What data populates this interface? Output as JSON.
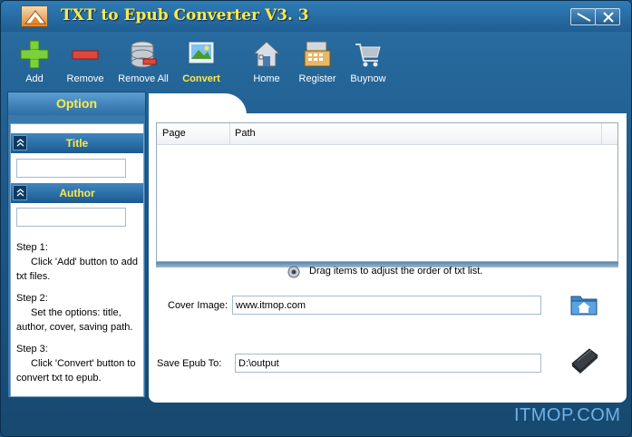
{
  "window": {
    "title": "TXT to Epub Converter V3. 3"
  },
  "toolbar": {
    "add": "Add",
    "remove": "Remove",
    "remove_all": "Remove All",
    "convert": "Convert",
    "home": "Home",
    "register": "Register",
    "buynow": "Buynow"
  },
  "sidebar": {
    "option_label": "Option",
    "title_label": "Title",
    "author_label": "Author",
    "title_value": "",
    "author_value": "",
    "steps": [
      {
        "title": "Step 1:",
        "body": "Click 'Add' button to add txt files."
      },
      {
        "title": "Step 2:",
        "body": "Set the options: title, author, cover, saving path."
      },
      {
        "title": "Step 3:",
        "body": "Click 'Convert' button to convert txt to epub."
      }
    ]
  },
  "file_list": {
    "columns": [
      "Page",
      "Path"
    ],
    "rows": []
  },
  "hint": "Drag items to  adjust the order of txt list.",
  "cover": {
    "label": "Cover Image:",
    "value": "www.itmop.com"
  },
  "save": {
    "label": "Save  Epub  To:",
    "value": "D:\\output"
  },
  "watermark": "ITMOP.COM",
  "colors": {
    "accent_yellow": "#ffe94a",
    "window_blue": "#1f5e93"
  }
}
